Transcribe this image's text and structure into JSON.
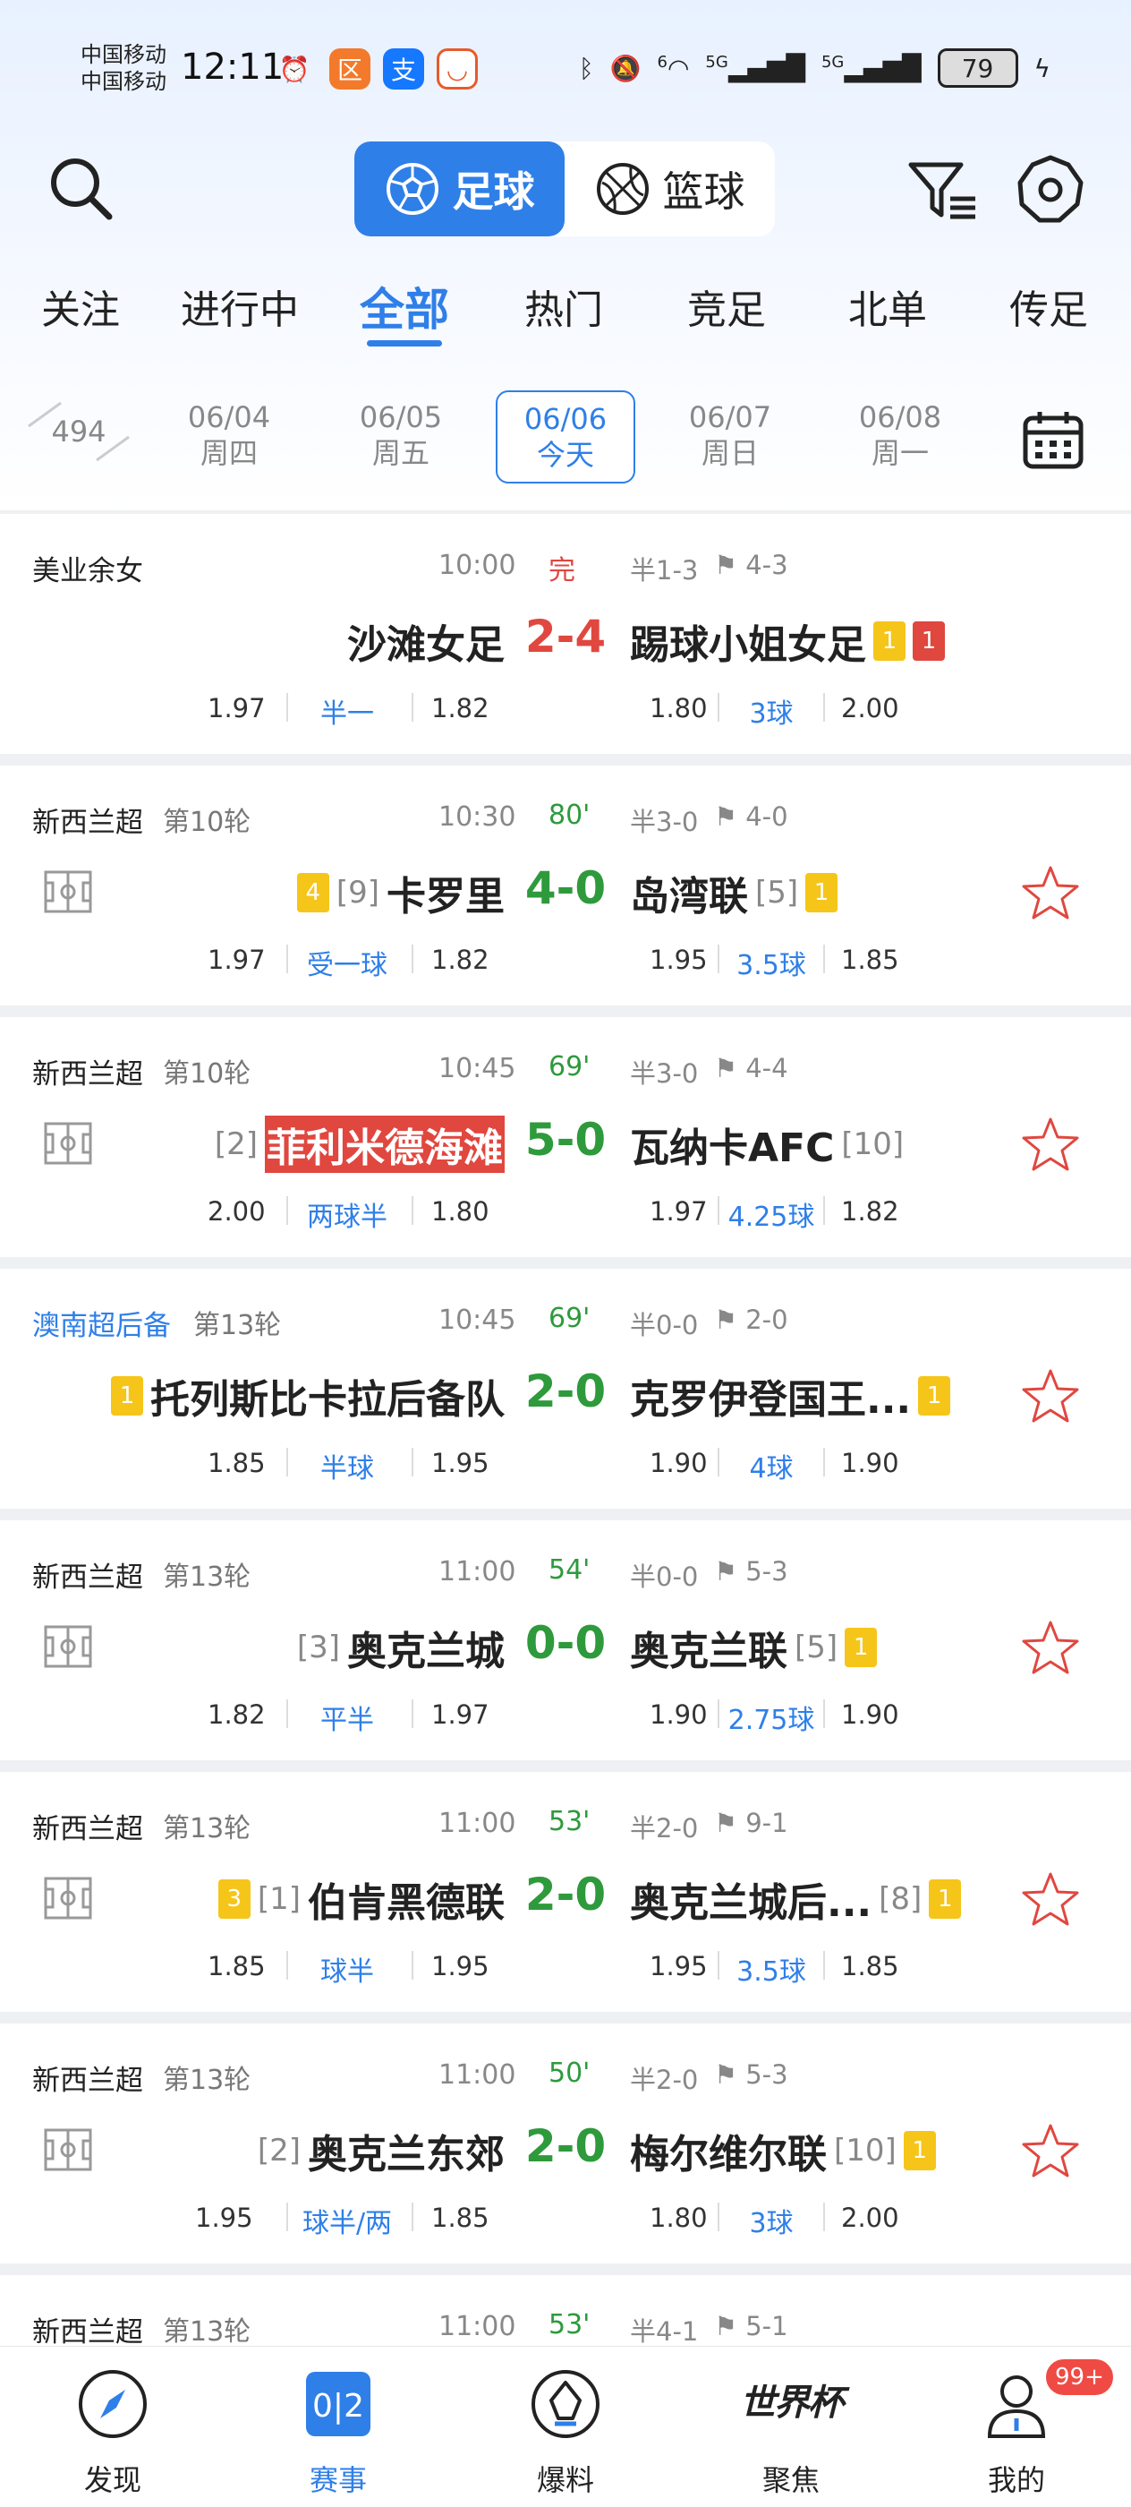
{
  "status_bar": {
    "carrier1": "中国移动",
    "carrier2": "中国移动",
    "time": "12:11",
    "battery": "79",
    "net1": "5G",
    "net2": "5G",
    "wifi_num": "6"
  },
  "header": {
    "sport_football": "足球",
    "sport_basketball": "篮球"
  },
  "tabs": [
    "关注",
    "进行中",
    "全部",
    "热门",
    "竞足",
    "北单",
    "传足"
  ],
  "dates": {
    "prev_count": "494",
    "items": [
      {
        "date": "06/04",
        "day": "周四"
      },
      {
        "date": "06/05",
        "day": "周五"
      },
      {
        "date": "06/06",
        "day": "今天"
      },
      {
        "date": "06/07",
        "day": "周日"
      },
      {
        "date": "06/08",
        "day": "周一"
      }
    ]
  },
  "matches": [
    {
      "league": "美业余女",
      "round": "",
      "time": "10:00",
      "status": "完",
      "ht": "半1-3",
      "corner": "4-3",
      "home": "沙滩女足",
      "home_rank": "",
      "home_y": "",
      "score": "2-4",
      "away": "踢球小姐女足",
      "away_rank": "",
      "away_y": "1",
      "away_r": "1",
      "o1": "1.97",
      "hcap": "半一",
      "o2": "1.82",
      "o3": "1.80",
      "goals": "3球",
      "o4": "2.00"
    },
    {
      "league": "新西兰超",
      "round": "第10轮",
      "time": "10:30",
      "status": "80'",
      "ht": "半3-0",
      "corner": "4-0",
      "home": "卡罗里",
      "home_rank": "[9]",
      "home_y": "4",
      "score": "4-0",
      "away": "岛湾联",
      "away_rank": "[5]",
      "away_y": "1",
      "away_r": "",
      "o1": "1.97",
      "hcap": "受一球",
      "o2": "1.82",
      "o3": "1.95",
      "goals": "3.5球",
      "o4": "1.85"
    },
    {
      "league": "新西兰超",
      "round": "第10轮",
      "time": "10:45",
      "status": "69'",
      "ht": "半3-0",
      "corner": "4-4",
      "home": "菲利米德海滩",
      "home_rank": "[2]",
      "home_y": "",
      "score": "5-0",
      "away": "瓦纳卡AFC",
      "away_rank": "[10]",
      "away_y": "",
      "away_r": "",
      "o1": "2.00",
      "hcap": "两球半",
      "o2": "1.80",
      "o3": "1.97",
      "goals": "4.25球",
      "o4": "1.82"
    },
    {
      "league": "澳南超后备",
      "round": "第13轮",
      "time": "10:45",
      "status": "69'",
      "ht": "半0-0",
      "corner": "2-0",
      "home": "托列斯比卡拉后备队",
      "home_rank": "",
      "home_y": "1",
      "score": "2-0",
      "away": "克罗伊登国王...",
      "away_rank": "",
      "away_y": "1",
      "away_r": "",
      "o1": "1.85",
      "hcap": "半球",
      "o2": "1.95",
      "o3": "1.90",
      "goals": "4球",
      "o4": "1.90"
    },
    {
      "league": "新西兰超",
      "round": "第13轮",
      "time": "11:00",
      "status": "54'",
      "ht": "半0-0",
      "corner": "5-3",
      "home": "奥克兰城",
      "home_rank": "[3]",
      "home_y": "",
      "score": "0-0",
      "away": "奥克兰联",
      "away_rank": "[5]",
      "away_y": "1",
      "away_r": "",
      "o1": "1.82",
      "hcap": "平半",
      "o2": "1.97",
      "o3": "1.90",
      "goals": "2.75球",
      "o4": "1.90"
    },
    {
      "league": "新西兰超",
      "round": "第13轮",
      "time": "11:00",
      "status": "53'",
      "ht": "半2-0",
      "corner": "9-1",
      "home": "伯肯黑德联",
      "home_rank": "[1]",
      "home_y": "3",
      "score": "2-0",
      "away": "奥克兰城后...",
      "away_rank": "[8]",
      "away_y": "1",
      "away_r": "",
      "o1": "1.85",
      "hcap": "球半",
      "o2": "1.95",
      "o3": "1.95",
      "goals": "3.5球",
      "o4": "1.85"
    },
    {
      "league": "新西兰超",
      "round": "第13轮",
      "time": "11:00",
      "status": "50'",
      "ht": "半2-0",
      "corner": "5-3",
      "home": "奥克兰东郊",
      "home_rank": "[2]",
      "home_y": "",
      "score": "2-0",
      "away": "梅尔维尔联",
      "away_rank": "[10]",
      "away_y": "1",
      "away_r": "",
      "o1": "1.95",
      "hcap": "球半/两",
      "o2": "1.85",
      "o3": "1.80",
      "goals": "3球",
      "o4": "2.00"
    },
    {
      "league": "新西兰超",
      "round": "第13轮",
      "time": "11:00",
      "status": "53'",
      "ht": "半4-1",
      "corner": "5-1",
      "home": "",
      "home_rank": "",
      "home_y": "",
      "score": "",
      "away": "",
      "away_rank": "",
      "away_y": "",
      "away_r": "",
      "o1": "",
      "hcap": "",
      "o2": "",
      "o3": "",
      "goals": "",
      "o4": ""
    }
  ],
  "bottom_nav": {
    "discover": "发现",
    "matches": "赛事",
    "scoop": "爆料",
    "focus": "聚焦",
    "worldcup": "世界杯",
    "mine": "我的",
    "badge": "99+",
    "score_icon": "0|2"
  },
  "colors": {
    "accent": "#2f7fe8",
    "score_green": "#2e9a3c",
    "score_red": "#e0473f",
    "yellow_card": "#f6c519"
  }
}
